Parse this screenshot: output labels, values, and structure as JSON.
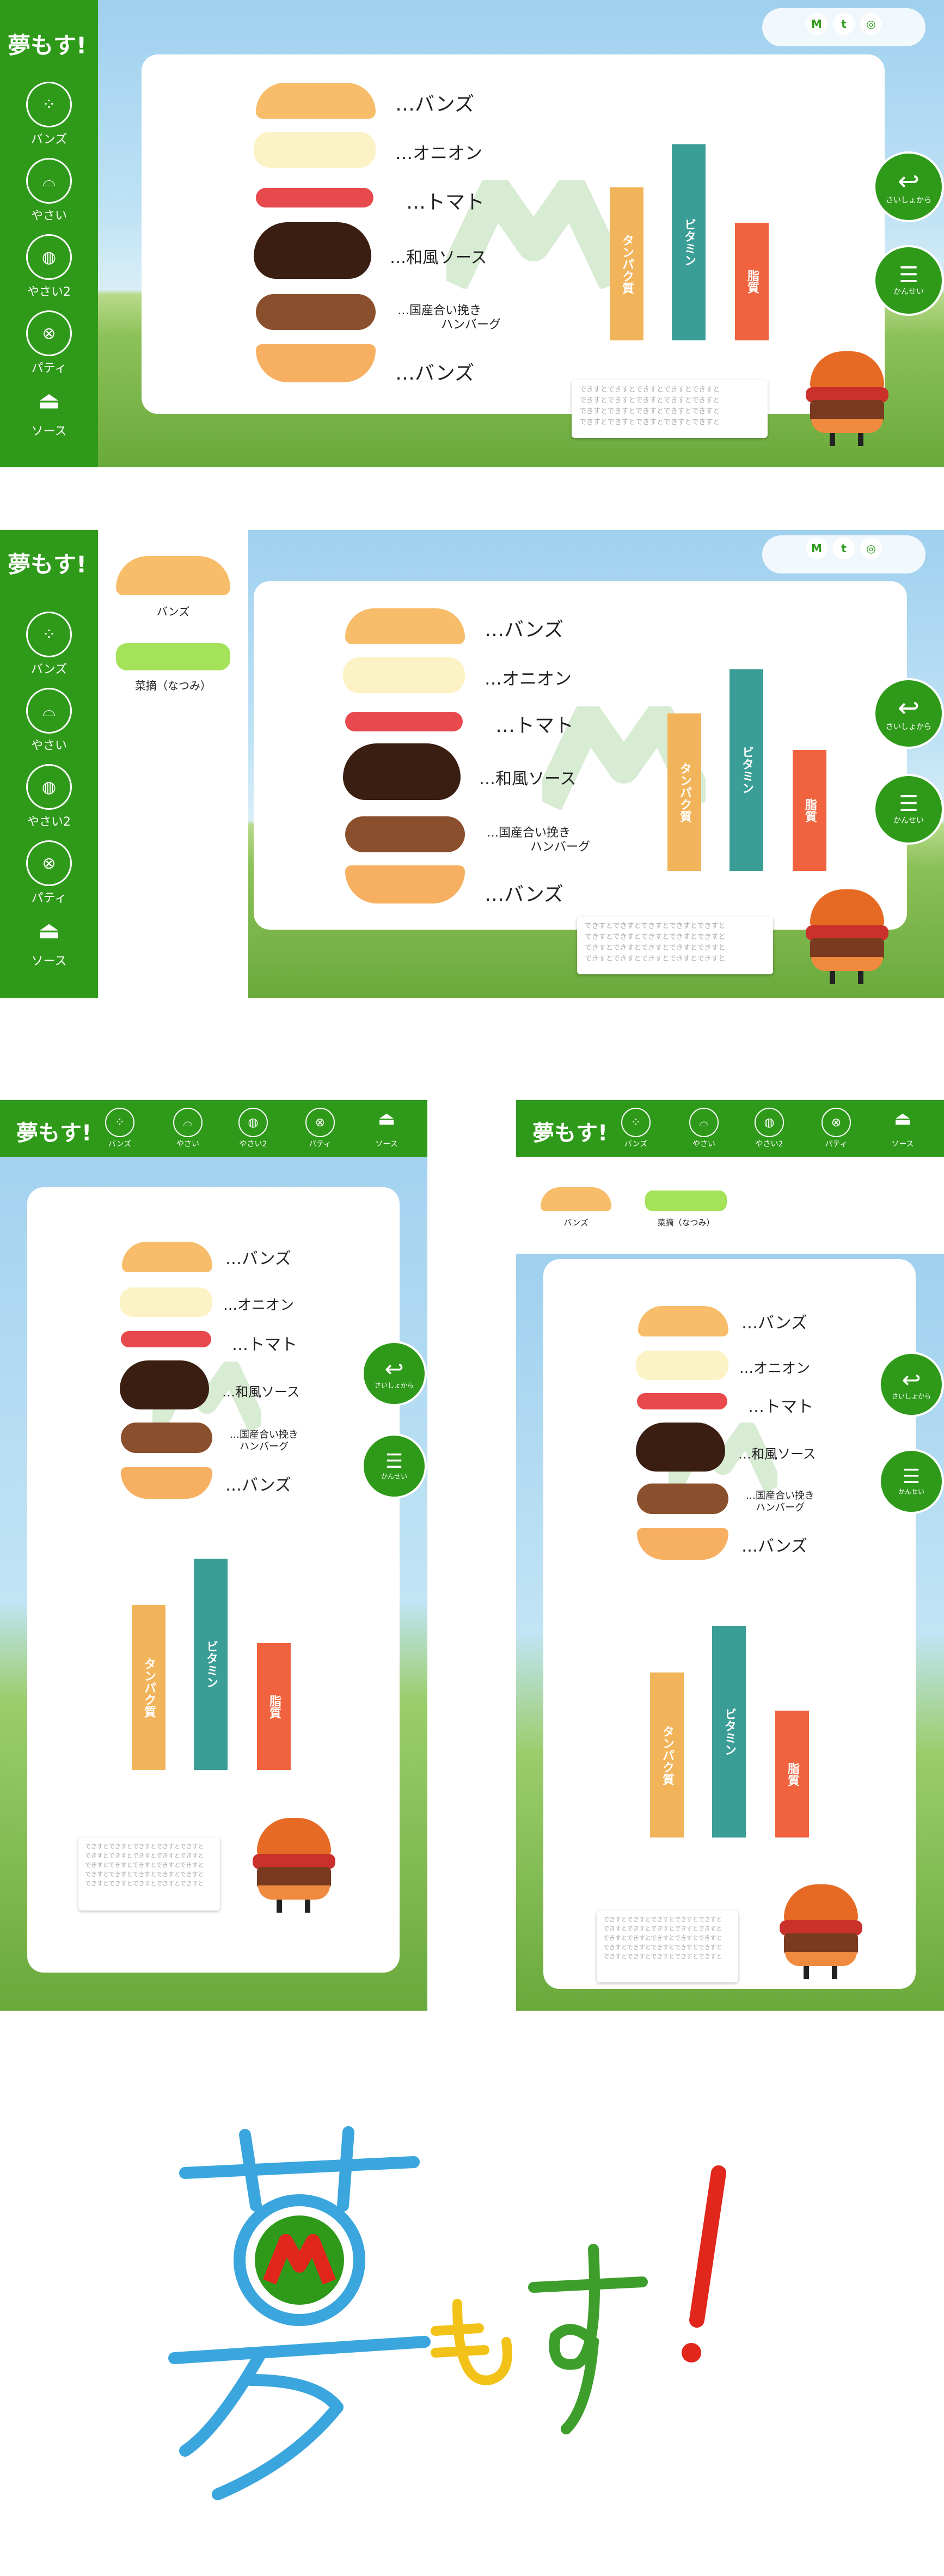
{
  "logo_text": "夢もす!",
  "nav": [
    {
      "label": "バンズ",
      "icon": "bun-icon"
    },
    {
      "label": "やさい",
      "icon": "tomato-icon"
    },
    {
      "label": "やさい2",
      "icon": "onion-icon"
    },
    {
      "label": "パティ",
      "icon": "patty-icon"
    },
    {
      "label": "ソース",
      "icon": "gravy-boat-icon"
    }
  ],
  "social": [
    "M",
    "t",
    "◎"
  ],
  "layers": [
    "…バンズ",
    "…オニオン",
    "…トマト",
    "…和風ソース",
    "…国産合い挽き\nハンバーグ",
    "…バンズ"
  ],
  "patty_line1": "…国産合い挽き",
  "patty_line2": "ハンバーグ",
  "chart_data": {
    "type": "bar",
    "categories": [
      "タンパク質",
      "ビタミン",
      "脂質"
    ],
    "values": [
      0.78,
      1.0,
      0.6
    ],
    "colors": [
      "#f2b45a",
      "#3a9e96",
      "#f0633e"
    ]
  },
  "bubble_text": "できすとできすとできすとできすとできすと",
  "buttons": {
    "restart": "さいしょから",
    "done": "かんせい"
  },
  "selected": [
    {
      "label": "バンズ"
    },
    {
      "label": "菜摘（なつみ）"
    }
  ],
  "colors": {
    "green": "#2f9a1a",
    "bun": "#f7bd6a",
    "tomato": "#e8494d",
    "sauce": "#3b1e12",
    "patty": "#8a4f2c"
  }
}
